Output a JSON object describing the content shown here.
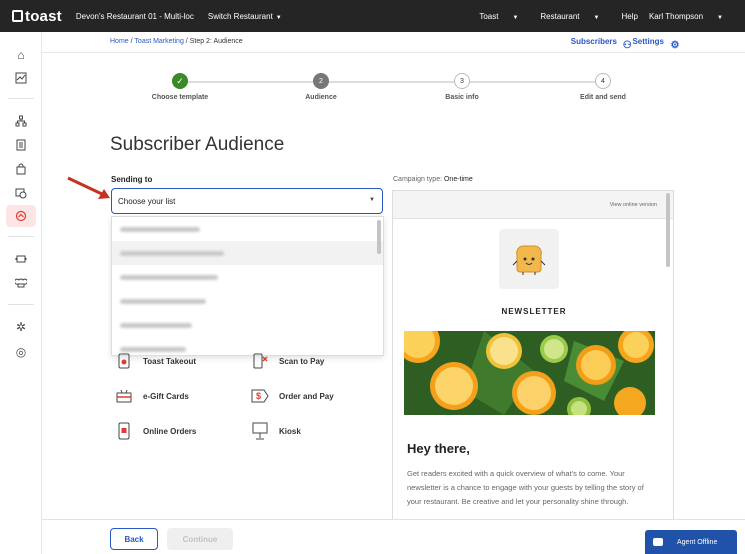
{
  "topbar": {
    "logo_text": "toast",
    "restaurant": "Devon's Restaurant 01 - Multi-loc",
    "switch_restaurant": "Switch Restaurant",
    "menu_toast": "Toast",
    "menu_restaurant": "Restaurant",
    "menu_help": "Help",
    "user_name": "Karl Thompson"
  },
  "breadcrumb": {
    "home": "Home",
    "sep": "/",
    "marketing": "Toast Marketing",
    "step": "Step 2: Audience"
  },
  "header_links": {
    "subscribers": "Subscribers",
    "settings": "Settings"
  },
  "steps": [
    {
      "number": "✓",
      "label": "Choose template",
      "state": "done"
    },
    {
      "number": "2",
      "label": "Audience",
      "state": "current"
    },
    {
      "number": "3",
      "label": "Basic info",
      "state": "todo"
    },
    {
      "number": "4",
      "label": "Edit and send",
      "state": "todo"
    }
  ],
  "page": {
    "title": "Subscriber Audience",
    "sending_to_label": "Sending to",
    "select_value": "Choose your list"
  },
  "features": [
    {
      "label": "Toast Takeout",
      "icon": "phone-icon"
    },
    {
      "label": "Scan to Pay",
      "icon": "qr-scan-icon"
    },
    {
      "label": "e-Gift Cards",
      "icon": "gift-card-icon"
    },
    {
      "label": "Order and Pay",
      "icon": "dollar-tag-icon"
    },
    {
      "label": "Online Orders",
      "icon": "mobile-order-icon"
    },
    {
      "label": "Kiosk",
      "icon": "kiosk-icon"
    }
  ],
  "preview": {
    "campaign_type_label": "Campaign type:",
    "campaign_type_value": "One-time",
    "view_online": "View online version",
    "newsletter_heading": "NEWSLETTER",
    "greeting": "Hey there,",
    "body": "Get readers excited with a quick overview of what's to come. Your newsletter is a chance to engage with your guests by telling the story of your restaurant. Be creative and let your personality shine through."
  },
  "footer": {
    "back": "Back",
    "continue": "Continue"
  },
  "chat": {
    "label": "Agent Offline"
  },
  "colors": {
    "topbar": "#252525",
    "link_blue": "#2957c5",
    "done_green": "#3a8a27",
    "active_nav": "#e4392f",
    "chat_blue": "#1f52a8"
  }
}
